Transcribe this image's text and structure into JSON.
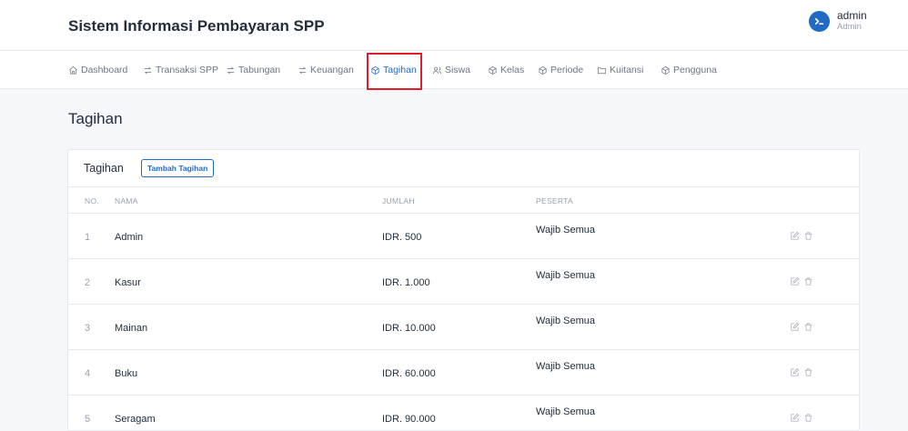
{
  "header": {
    "title": "Sistem Informasi Pembayaran SPP",
    "user_name": "admin",
    "user_role": "Admin"
  },
  "nav": [
    {
      "label": "Dashboard",
      "icon": "home-icon"
    },
    {
      "label": "Transaksi SPP",
      "icon": "transfer-icon"
    },
    {
      "label": "Tabungan",
      "icon": "transfer-icon"
    },
    {
      "label": "Keuangan",
      "icon": "transfer-icon"
    },
    {
      "label": "Tagihan",
      "icon": "box-icon",
      "active": true
    },
    {
      "label": "Siswa",
      "icon": "users-icon"
    },
    {
      "label": "Kelas",
      "icon": "box-icon"
    },
    {
      "label": "Periode",
      "icon": "box-icon"
    },
    {
      "label": "Kuitansi",
      "icon": "folder-icon"
    },
    {
      "label": "Pengguna",
      "icon": "box-icon"
    }
  ],
  "page": {
    "title": "Tagihan"
  },
  "card": {
    "title": "Tagihan",
    "add_button": "Tambah Tagihan"
  },
  "table": {
    "columns": [
      "NO.",
      "NAMA",
      "JUMLAH",
      "PESERTA"
    ],
    "rows": [
      {
        "no": "1",
        "nama": "Admin",
        "jumlah": "IDR. 500",
        "peserta": "Wajib Semua"
      },
      {
        "no": "2",
        "nama": "Kasur",
        "jumlah": "IDR. 1.000",
        "peserta": "Wajib Semua"
      },
      {
        "no": "3",
        "nama": "Mainan",
        "jumlah": "IDR. 10.000",
        "peserta": "Wajib Semua"
      },
      {
        "no": "4",
        "nama": "Buku",
        "jumlah": "IDR. 60.000",
        "peserta": "Wajib Semua"
      },
      {
        "no": "5",
        "nama": "Seragam",
        "jumlah": "IDR. 90.000",
        "peserta": "Wajib Semua"
      }
    ]
  },
  "colors": {
    "accent": "#206bc4",
    "highlight_border": "#e11d2a"
  }
}
